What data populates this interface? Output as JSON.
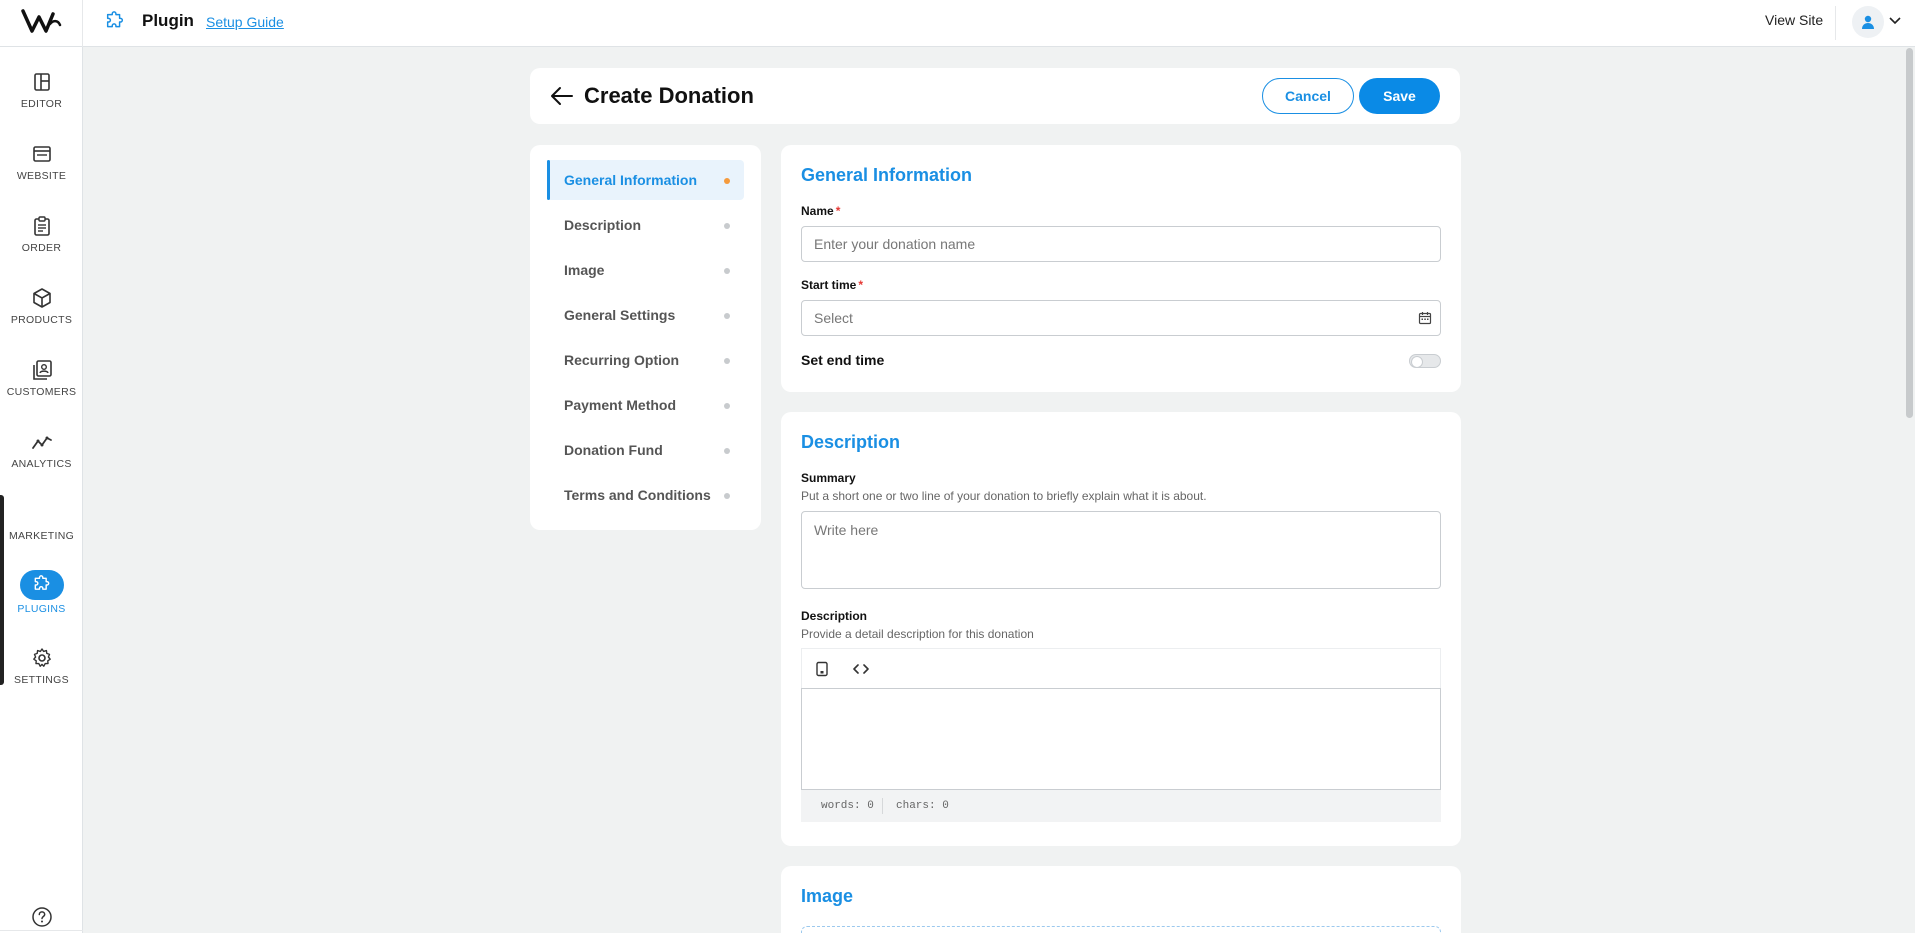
{
  "topbar": {
    "page_name": "Plugin",
    "setup_guide": "Setup Guide",
    "view_site": "View Site"
  },
  "leftnav": {
    "items": [
      {
        "label": "EDITOR",
        "icon": "layout-icon"
      },
      {
        "label": "WEBSITE",
        "icon": "browser-icon"
      },
      {
        "label": "ORDER",
        "icon": "clipboard-icon"
      },
      {
        "label": "PRODUCTS",
        "icon": "cube-icon"
      },
      {
        "label": "CUSTOMERS",
        "icon": "contacts-icon"
      },
      {
        "label": "ANALYTICS",
        "icon": "trend-icon"
      },
      {
        "label": "MARKETING",
        "icon": "megaphone-icon"
      },
      {
        "label": "PLUGINS",
        "icon": "puzzle-icon",
        "active": true
      },
      {
        "label": "SETTINGS",
        "icon": "gear-icon"
      }
    ]
  },
  "header": {
    "title": "Create Donation",
    "cancel": "Cancel",
    "save": "Save"
  },
  "sections": {
    "items": [
      {
        "label": "General Information",
        "active": true
      },
      {
        "label": "Description"
      },
      {
        "label": "Image"
      },
      {
        "label": "General Settings"
      },
      {
        "label": "Recurring Option"
      },
      {
        "label": "Payment Method"
      },
      {
        "label": "Donation Fund"
      },
      {
        "label": "Terms and Conditions"
      }
    ]
  },
  "general": {
    "title": "General Information",
    "name_label": "Name",
    "name_placeholder": "Enter your donation name",
    "start_label": "Start time",
    "start_placeholder": "Select",
    "end_label": "Set end time",
    "required_mark": "*"
  },
  "description": {
    "title": "Description",
    "summary_label": "Summary",
    "summary_hint": "Put a short one or two line of your donation to briefly explain what it is about.",
    "summary_placeholder": "Write here",
    "desc_label": "Description",
    "desc_hint": "Provide a detail description for this donation",
    "words": "words: 0",
    "chars": "chars: 0"
  },
  "image": {
    "title": "Image"
  },
  "colors": {
    "accent": "#1a8fe3",
    "save_button": "#0a8ae6",
    "active_dot": "#f59a3c",
    "background": "#f0f2f2"
  }
}
